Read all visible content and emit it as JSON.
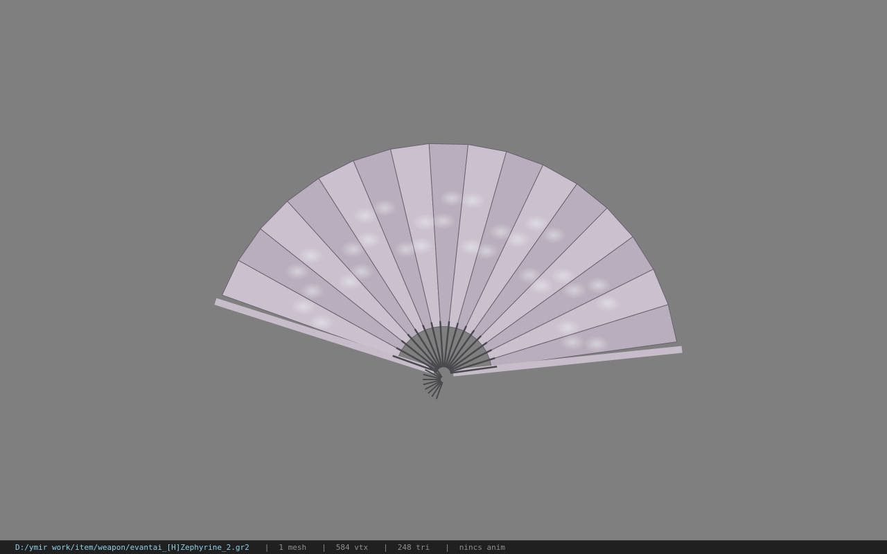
{
  "viewer": {
    "background_color": "#7f7f7f",
    "model": {
      "name": "fan-model",
      "paper_color": "#c9bfcc",
      "paper_pattern_color": "#e6eef0",
      "rib_color": "#4a4a4e"
    }
  },
  "statusbar": {
    "path": "D:/ymir work/item/weapon/evantai_[H]Zephyrine_2.gr2",
    "separator": "|",
    "mesh_count": "1 mesh",
    "vertex_count": "584 vtx",
    "triangle_count": "248 tri",
    "anim": "nincs anim"
  }
}
